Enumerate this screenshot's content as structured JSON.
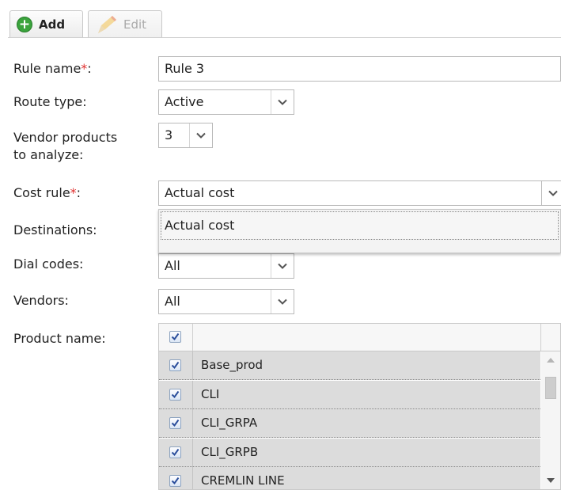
{
  "toolbar": {
    "add_label": "Add",
    "edit_label": "Edit"
  },
  "form": {
    "rule_name": {
      "label": "Rule name",
      "required_mark": "*",
      "colon": ":",
      "value": "Rule 3"
    },
    "route_type": {
      "label": "Route type:",
      "value": "Active"
    },
    "vendor_products": {
      "label_line1": "Vendor products",
      "label_line2": "to analyze:",
      "value": "3"
    },
    "cost_rule": {
      "label": "Cost rule",
      "required_mark": "*",
      "colon": ":",
      "value": "Actual cost"
    },
    "cost_rule_options": [
      "Actual cost"
    ],
    "destinations": {
      "label": "Destinations:"
    },
    "dial_codes": {
      "label": "Dial codes:",
      "value": "All"
    },
    "vendors": {
      "label": "Vendors:",
      "value": "All"
    },
    "product_name": {
      "label": "Product name:",
      "header_checked": true,
      "rows": [
        {
          "name": "Base_prod",
          "checked": true
        },
        {
          "name": "CLI",
          "checked": true
        },
        {
          "name": "CLI_GRPA",
          "checked": true
        },
        {
          "name": "CLI_GRPB",
          "checked": true
        },
        {
          "name": "CREMLIN LINE",
          "checked": true
        }
      ]
    }
  },
  "colors": {
    "required": "#e0302f",
    "add_icon": "#3aa33c",
    "checkbox_check": "#2a4d9b",
    "row_bg": "#dcdcdc"
  },
  "icons": {
    "add": "plus-circle-icon",
    "edit": "pencil-icon",
    "dropdown": "chevron-down-icon",
    "checkbox": "checkmark-icon"
  }
}
